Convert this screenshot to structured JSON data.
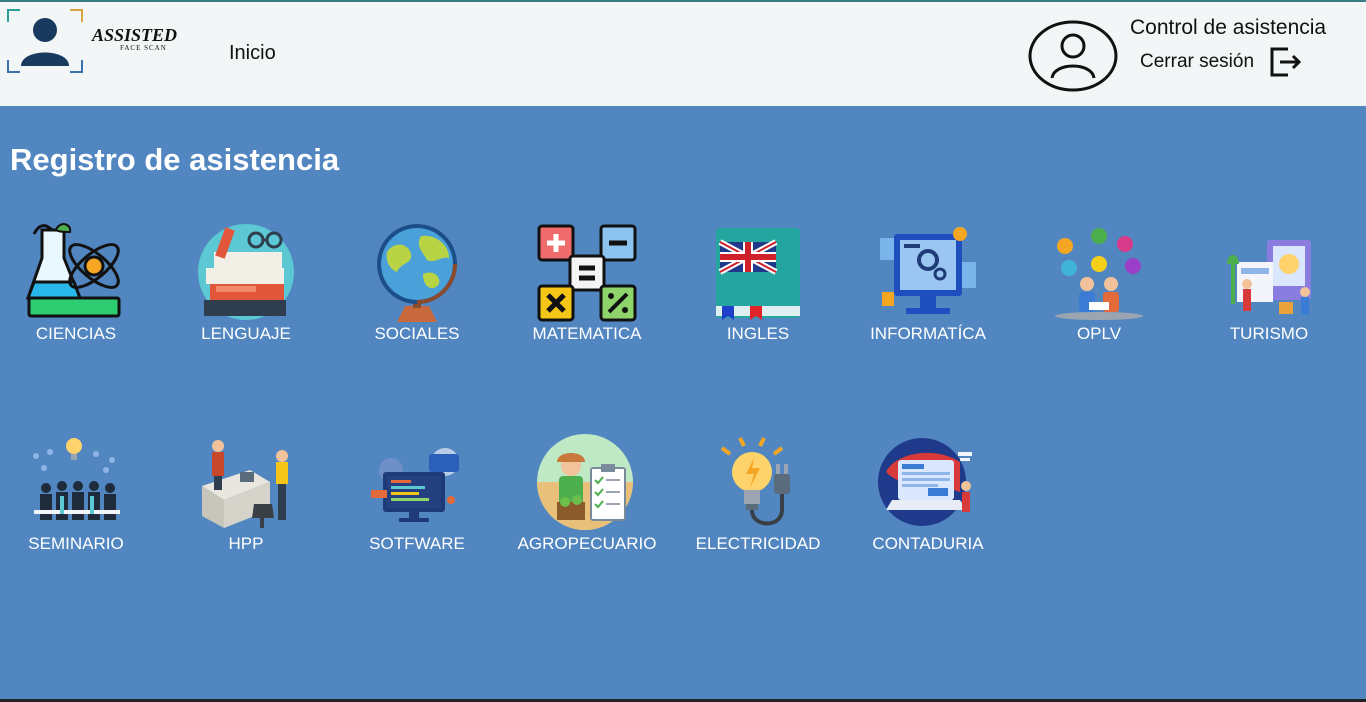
{
  "header": {
    "logo_title": "ASSISTED",
    "logo_subtitle": "FACE SCAN",
    "nav_inicio": "Inicio",
    "app_title": "Control de asistencia",
    "logout_label": "Cerrar sesión"
  },
  "main": {
    "title": "Registro de asistencia",
    "subjects": [
      {
        "label": "CIENCIAS",
        "icon": "science-flask-atom-icon"
      },
      {
        "label": "LENGUAJE",
        "icon": "books-glasses-icon"
      },
      {
        "label": "SOCIALES",
        "icon": "globe-icon"
      },
      {
        "label": "MATEMATICA",
        "icon": "math-operators-icon"
      },
      {
        "label": "INGLES",
        "icon": "english-book-flag-icon"
      },
      {
        "label": "INFORMATÍCA",
        "icon": "computer-gears-icon"
      },
      {
        "label": "OPLV",
        "icon": "students-ideas-icon"
      },
      {
        "label": "TURISMO",
        "icon": "tourism-travel-icon"
      },
      {
        "label": "SEMINARIO",
        "icon": "seminar-group-icon"
      },
      {
        "label": "HPP",
        "icon": "office-desk-people-icon"
      },
      {
        "label": "SOTFWARE",
        "icon": "software-screens-icon"
      },
      {
        "label": "AGROPECUARIO",
        "icon": "farmer-checklist-icon"
      },
      {
        "label": "ELECTRICIDAD",
        "icon": "lightbulb-plug-icon"
      },
      {
        "label": "CONTADURIA",
        "icon": "accounting-laptop-icon"
      }
    ]
  },
  "colors": {
    "header_bg": "#f2f6f7",
    "page_bg": "#5186c1",
    "text_white": "#ffffff"
  }
}
